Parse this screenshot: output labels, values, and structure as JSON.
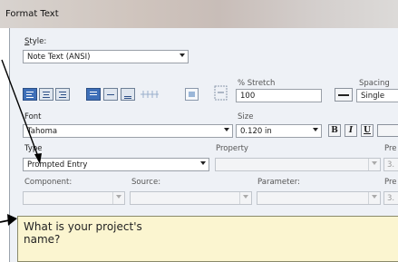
{
  "window": {
    "title": "Format Text"
  },
  "style": {
    "label": "Style:",
    "label_u": "S",
    "label_rest": "tyle:",
    "value": "Note Text (ANSI)"
  },
  "stretch": {
    "label": "% Stretch",
    "value": "100"
  },
  "spacing": {
    "label": "Spacing",
    "value": "Single"
  },
  "font": {
    "label": "Font",
    "value": "Tahoma"
  },
  "size": {
    "label": "Size",
    "value": "0.120 in"
  },
  "format": {
    "bold": "B",
    "italic": "I",
    "underline": "U"
  },
  "type": {
    "label": "Type",
    "value": "Prompted Entry"
  },
  "property": {
    "label": "Property",
    "value": ""
  },
  "precision_top": {
    "label": "Pre",
    "value": "3."
  },
  "component": {
    "label": "Component:",
    "value": ""
  },
  "source": {
    "label": "Source:",
    "value": ""
  },
  "parameter": {
    "label": "Parameter:",
    "value": ""
  },
  "precision_bottom": {
    "label": "Pre",
    "value": "3."
  },
  "prompt_text": {
    "line1": "What is your project's",
    "line2": "name?"
  },
  "colors": {
    "accent": "#3e6fb8",
    "text_area_bg": "#fbf5d0"
  }
}
